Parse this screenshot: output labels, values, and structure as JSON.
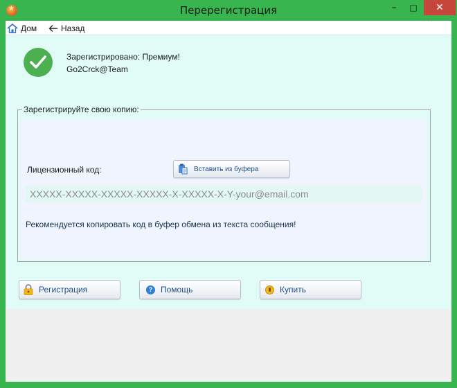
{
  "window": {
    "title": "Перерегистрация",
    "controls": {
      "minimize": "–",
      "maximize": "□",
      "close": "✕"
    },
    "accent_color": "#38b54f"
  },
  "nav": {
    "home_label": "Дом",
    "back_label": "Назад"
  },
  "status": {
    "icon": "check-circle-icon",
    "line1": "Зарегистрировано: Премиум!",
    "line2": "Go2Crck@Team"
  },
  "register_group": {
    "title": "Зарегистрируйте свою копию:",
    "license_label": "Лицензионный код:",
    "paste_button": "Вставить из буфера",
    "license_input": {
      "value": "",
      "placeholder": "XXXXX-XXXXX-XXXXX-XXXXX-X-XXXXX-X-Y-your@email.com"
    },
    "hint": "Рекомендуется копировать код в буфер обмена из текста сообщения!"
  },
  "actions": {
    "register": "Регистрация",
    "help": "Помощь",
    "buy": "Купить"
  }
}
